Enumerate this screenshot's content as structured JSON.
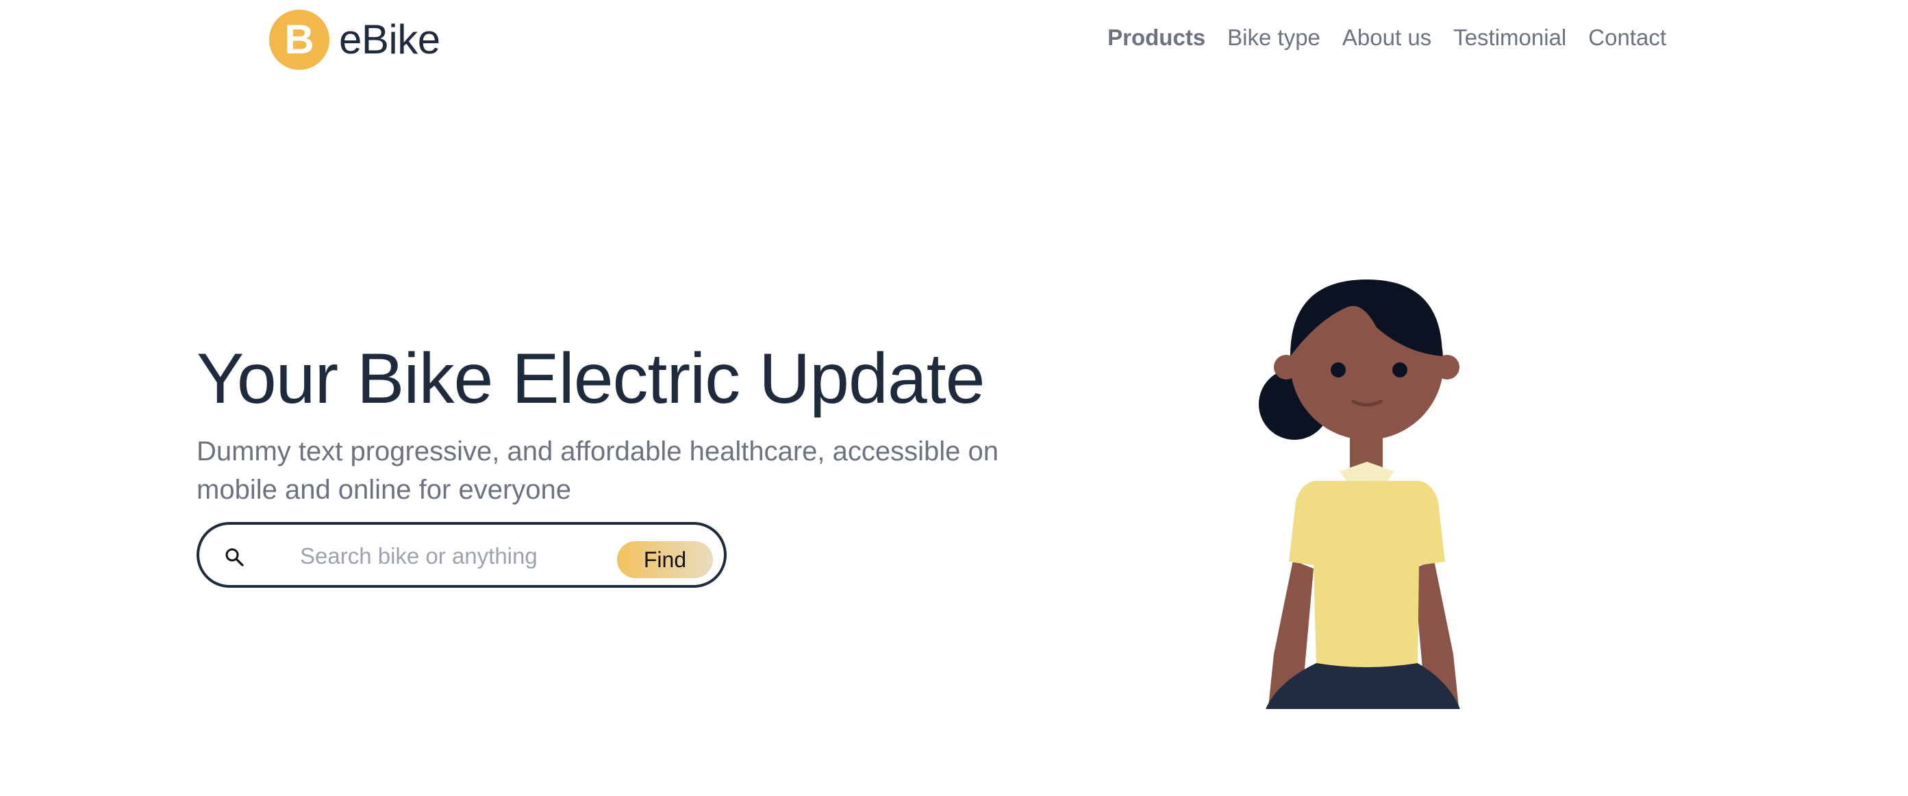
{
  "header": {
    "logo_letter": "B",
    "brand_name": "eBike",
    "nav": [
      {
        "label": "Products",
        "active": true
      },
      {
        "label": "Bike type",
        "active": false
      },
      {
        "label": "About us",
        "active": false
      },
      {
        "label": "Testimonial",
        "active": false
      },
      {
        "label": "Contact",
        "active": false
      }
    ]
  },
  "hero": {
    "title": "Your Bike Electric Update",
    "subtitle": "Dummy text progressive, and affordable healthcare, accessible on mobile and online for everyone",
    "search": {
      "placeholder": "Search bike or anything",
      "value": "",
      "button_label": "Find",
      "icon": "search-icon"
    }
  },
  "colors": {
    "accent": "#f2b84b",
    "text_dark": "#1f2a3c",
    "text_muted": "#6b7280",
    "hair": "#0b1322",
    "skin": "#8a5548",
    "shirt": "#f0dc82",
    "skirt": "#222c41"
  }
}
